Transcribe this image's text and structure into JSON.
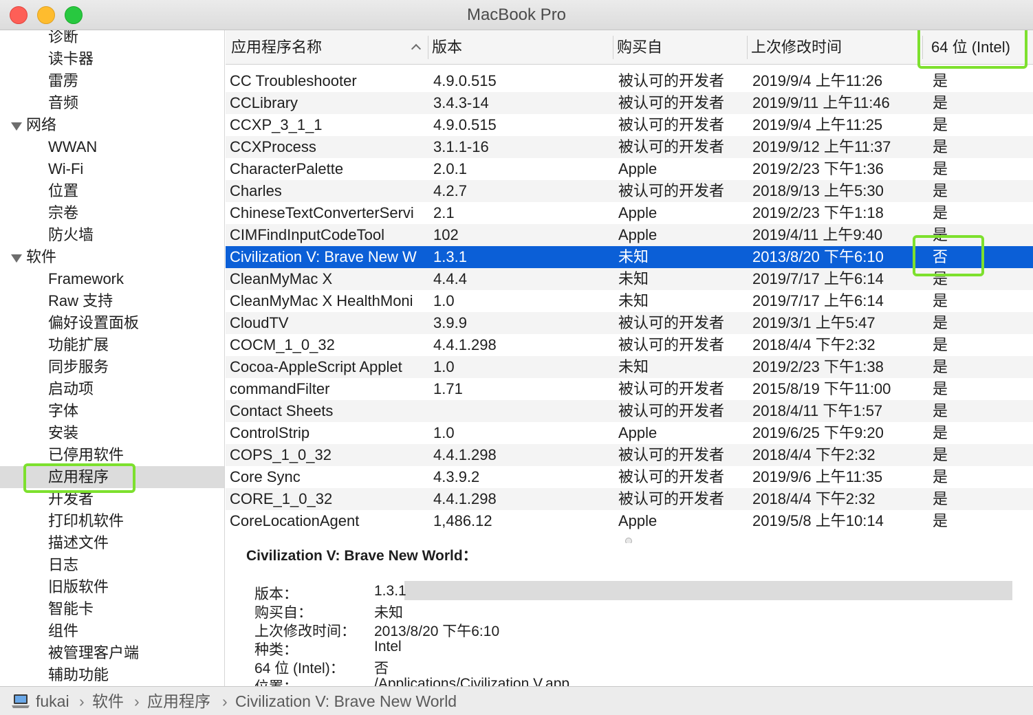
{
  "window": {
    "title": "MacBook Pro"
  },
  "sidebar": {
    "items": [
      {
        "label": "诊断",
        "type": "child"
      },
      {
        "label": "读卡器",
        "type": "child"
      },
      {
        "label": "雷雳",
        "type": "child"
      },
      {
        "label": "音频",
        "type": "child"
      },
      {
        "label": "网络",
        "type": "group"
      },
      {
        "label": "WWAN",
        "type": "child"
      },
      {
        "label": "Wi-Fi",
        "type": "child"
      },
      {
        "label": "位置",
        "type": "child"
      },
      {
        "label": "宗卷",
        "type": "child"
      },
      {
        "label": "防火墙",
        "type": "child"
      },
      {
        "label": "软件",
        "type": "group"
      },
      {
        "label": "Framework",
        "type": "child"
      },
      {
        "label": "Raw 支持",
        "type": "child"
      },
      {
        "label": "偏好设置面板",
        "type": "child"
      },
      {
        "label": "功能扩展",
        "type": "child"
      },
      {
        "label": "同步服务",
        "type": "child"
      },
      {
        "label": "启动项",
        "type": "child"
      },
      {
        "label": "字体",
        "type": "child"
      },
      {
        "label": "安装",
        "type": "child"
      },
      {
        "label": "已停用软件",
        "type": "child"
      },
      {
        "label": "应用程序",
        "type": "child",
        "selected": true
      },
      {
        "label": "开发者",
        "type": "child"
      },
      {
        "label": "打印机软件",
        "type": "child"
      },
      {
        "label": "描述文件",
        "type": "child"
      },
      {
        "label": "日志",
        "type": "child"
      },
      {
        "label": "旧版软件",
        "type": "child"
      },
      {
        "label": "智能卡",
        "type": "child"
      },
      {
        "label": "组件",
        "type": "child"
      },
      {
        "label": "被管理客户端",
        "type": "child"
      },
      {
        "label": "辅助功能",
        "type": "child"
      }
    ]
  },
  "table": {
    "columns": {
      "name": "应用程序名称",
      "version": "版本",
      "source": "购买自",
      "modified": "上次修改时间",
      "bit64": "64 位 (Intel)"
    },
    "rows": [
      {
        "name": "CC Troubleshooter",
        "version": "4.9.0.515",
        "source": "被认可的开发者",
        "modified": "2019/9/4 上午11:26",
        "bit64": "是"
      },
      {
        "name": "CCLibrary",
        "version": "3.4.3-14",
        "source": "被认可的开发者",
        "modified": "2019/9/11 上午11:46",
        "bit64": "是"
      },
      {
        "name": "CCXP_3_1_1",
        "version": "4.9.0.515",
        "source": "被认可的开发者",
        "modified": "2019/9/4 上午11:25",
        "bit64": "是"
      },
      {
        "name": "CCXProcess",
        "version": "3.1.1-16",
        "source": "被认可的开发者",
        "modified": "2019/9/12 上午11:37",
        "bit64": "是"
      },
      {
        "name": "CharacterPalette",
        "version": "2.0.1",
        "source": "Apple",
        "modified": "2019/2/23 下午1:36",
        "bit64": "是"
      },
      {
        "name": "Charles",
        "version": "4.2.7",
        "source": "被认可的开发者",
        "modified": "2018/9/13 上午5:30",
        "bit64": "是"
      },
      {
        "name": "ChineseTextConverterServi",
        "version": "2.1",
        "source": "Apple",
        "modified": "2019/2/23 下午1:18",
        "bit64": "是"
      },
      {
        "name": "CIMFindInputCodeTool",
        "version": "102",
        "source": "Apple",
        "modified": "2019/4/11 上午9:40",
        "bit64": "是"
      },
      {
        "name": "Civilization V: Brave New W",
        "version": "1.3.1",
        "source": "未知",
        "modified": "2013/8/20 下午6:10",
        "bit64": "否",
        "selected": true
      },
      {
        "name": "CleanMyMac X",
        "version": "4.4.4",
        "source": "未知",
        "modified": "2019/7/17 上午6:14",
        "bit64": "是"
      },
      {
        "name": "CleanMyMac X HealthMoni",
        "version": "1.0",
        "source": "未知",
        "modified": "2019/7/17 上午6:14",
        "bit64": "是"
      },
      {
        "name": "CloudTV",
        "version": "3.9.9",
        "source": "被认可的开发者",
        "modified": "2019/3/1 上午5:47",
        "bit64": "是"
      },
      {
        "name": "COCM_1_0_32",
        "version": "4.4.1.298",
        "source": "被认可的开发者",
        "modified": "2018/4/4 下午2:32",
        "bit64": "是"
      },
      {
        "name": "Cocoa-AppleScript Applet",
        "version": "1.0",
        "source": "未知",
        "modified": "2019/2/23 下午1:38",
        "bit64": "是"
      },
      {
        "name": "commandFilter",
        "version": "1.71",
        "source": "被认可的开发者",
        "modified": "2015/8/19 下午11:00",
        "bit64": "是"
      },
      {
        "name": "Contact Sheets",
        "version": "",
        "source": "被认可的开发者",
        "modified": "2018/4/11 下午1:57",
        "bit64": "是"
      },
      {
        "name": "ControlStrip",
        "version": "1.0",
        "source": "Apple",
        "modified": "2019/6/25 下午9:20",
        "bit64": "是"
      },
      {
        "name": "COPS_1_0_32",
        "version": "4.4.1.298",
        "source": "被认可的开发者",
        "modified": "2018/4/4 下午2:32",
        "bit64": "是"
      },
      {
        "name": "Core Sync",
        "version": "4.3.9.2",
        "source": "被认可的开发者",
        "modified": "2019/9/6 上午11:35",
        "bit64": "是"
      },
      {
        "name": "CORE_1_0_32",
        "version": "4.4.1.298",
        "source": "被认可的开发者",
        "modified": "2018/4/4 下午2:32",
        "bit64": "是"
      },
      {
        "name": "CoreLocationAgent",
        "version": "1,486.12",
        "source": "Apple",
        "modified": "2019/5/8 上午10:14",
        "bit64": "是"
      }
    ]
  },
  "detail": {
    "title": "Civilization V: Brave New World：",
    "fields": [
      {
        "label": "版本：",
        "value": "1.3.1"
      },
      {
        "label": "购买自：",
        "value": "未知"
      },
      {
        "label": "上次修改时间：",
        "value": "2013/8/20 下午6:10"
      },
      {
        "label": "种类：",
        "value": "Intel"
      },
      {
        "label": "64 位 (Intel)：",
        "value": "否"
      },
      {
        "label": "位置：",
        "value": "/Applications/Civilization V.app"
      }
    ]
  },
  "pathbar": {
    "crumbs": [
      "fukai",
      "软件",
      "应用程序",
      "Civilization V: Brave New World"
    ],
    "separator": "›"
  },
  "colors": {
    "selection": "#0b5fd7",
    "highlight_box": "#7de02e"
  }
}
